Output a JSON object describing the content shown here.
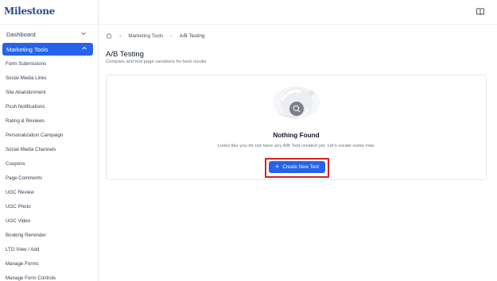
{
  "brand": {
    "logo_text": "Milestone"
  },
  "sidebar": {
    "dashboard_label": "Dashboard",
    "marketing_label": "Marketing Tools",
    "items": [
      {
        "label": "Form Submissions"
      },
      {
        "label": "Social Media Links"
      },
      {
        "label": "Site Abandonment"
      },
      {
        "label": "Push Notifications"
      },
      {
        "label": "Rating & Reviews"
      },
      {
        "label": "Personalization Campaign"
      },
      {
        "label": "Social Media Channels"
      },
      {
        "label": "Coupons"
      },
      {
        "label": "Page Comments"
      },
      {
        "label": "UGC Review"
      },
      {
        "label": "UGC Photo"
      },
      {
        "label": "UGC Video"
      },
      {
        "label": "Booking Reminder"
      },
      {
        "label": "LTO View / Add"
      },
      {
        "label": "Manage Forms"
      },
      {
        "label": "Manage Form Controls"
      }
    ]
  },
  "breadcrumb": {
    "home_icon": "home-icon",
    "items": [
      "Marketing Tools",
      "A/B Testing"
    ]
  },
  "page": {
    "title": "A/B Testing",
    "subtitle": "Compare and test page variations for best results"
  },
  "empty_state": {
    "title": "Nothing Found",
    "message": "Looks like you do not have any A/B Test created yet. Let's create some now.",
    "button_label": "Create New Test",
    "illustration_icon": "search-empty-illustration"
  },
  "colors": {
    "accent": "#2563eb",
    "highlight_border": "#d6202a",
    "logo": "#2b4a8c"
  }
}
